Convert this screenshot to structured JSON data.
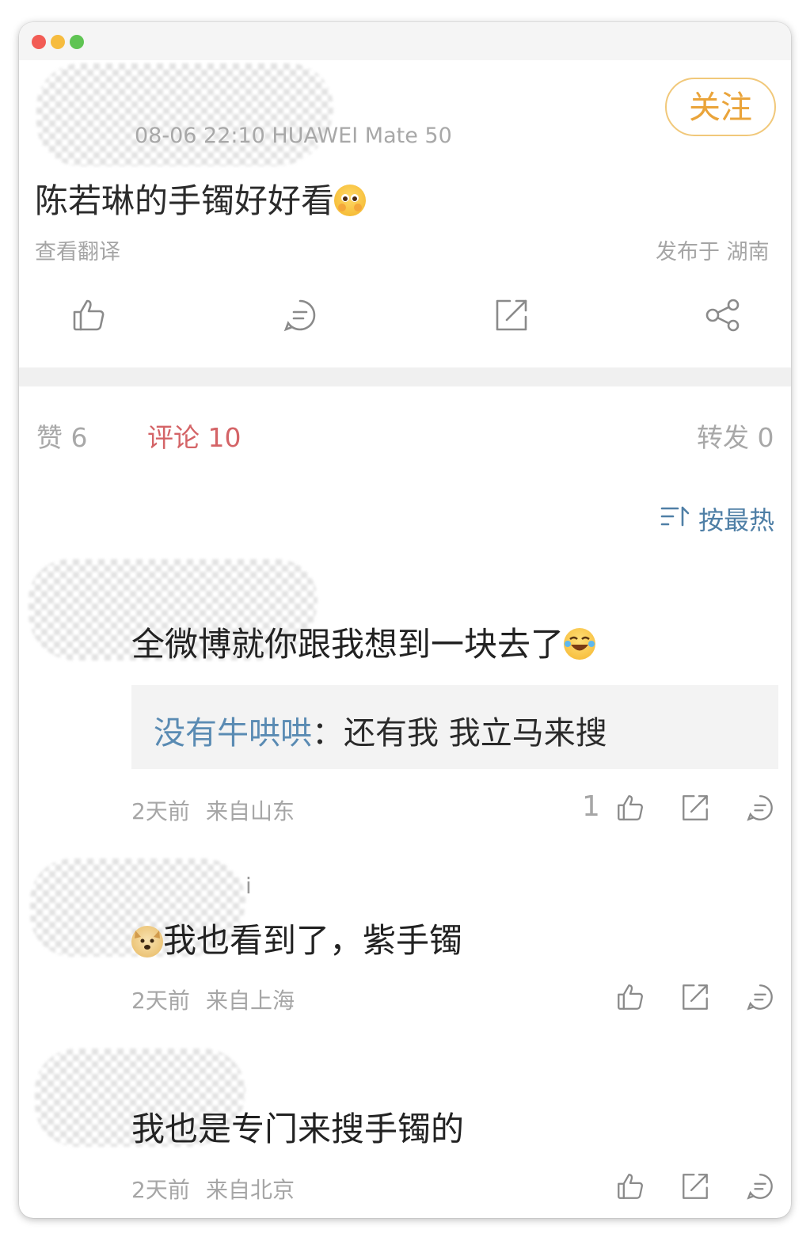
{
  "window": {
    "title": ""
  },
  "post": {
    "meta": "08-06 22:10   HUAWEI Mate 50",
    "follow_label": "关注",
    "text": "陈若琳的手镯好好看",
    "translate_label": "查看翻译",
    "location": "发布于 湖南"
  },
  "tabs": {
    "likes": "赞 6",
    "comments": "评论 10",
    "reposts": "转发 0"
  },
  "sort": {
    "label": "按最热"
  },
  "comments": [
    {
      "text": "全微博就你跟我想到一块去了",
      "reply_name": "没有牛哄哄",
      "reply_sep": "：",
      "reply_text": "还有我 我立马来搜",
      "time": "2天前",
      "source": "来自山东",
      "likes": "1"
    },
    {
      "username_tail": "i",
      "text": "我也看到了，紫手镯",
      "time": "2天前",
      "source": "来自上海"
    },
    {
      "text": "我也是专门来搜手镯的",
      "time": "2天前",
      "source": "来自北京"
    }
  ],
  "icons": {
    "post_actions": [
      "thumbs-up-icon",
      "comment-icon",
      "repost-icon",
      "share-icon"
    ],
    "comment_actions": [
      "thumbs-up-icon",
      "repost-icon",
      "comment-icon"
    ],
    "sort": "sort-icon"
  },
  "colors": {
    "follow": "#eaa43a",
    "active_tab": "#d46467",
    "link_blue": "#5a8bb3",
    "sort_blue": "#4f7fa6"
  }
}
